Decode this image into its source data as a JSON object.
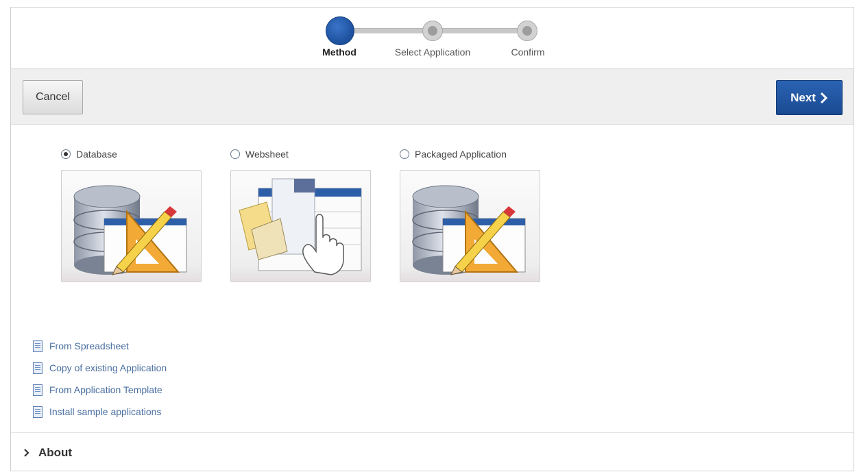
{
  "wizard": {
    "steps": [
      {
        "label": "Method",
        "state": "current"
      },
      {
        "label": "Select Application",
        "state": "future"
      },
      {
        "label": "Confirm",
        "state": "future"
      }
    ]
  },
  "buttons": {
    "cancel": "Cancel",
    "next": "Next",
    "next_icon": "chevron-right-icon"
  },
  "options": [
    {
      "label": "Database",
      "checked": true,
      "image": "database-icon"
    },
    {
      "label": "Websheet",
      "checked": false,
      "image": "websheet-icon"
    },
    {
      "label": "Packaged Application",
      "checked": false,
      "image": "database-icon"
    }
  ],
  "links": [
    "From Spreadsheet",
    "Copy of existing Application",
    "From Application Template",
    "Install sample applications"
  ],
  "about": {
    "label": "About",
    "icon": "chevron-right-icon"
  },
  "colors": {
    "primary": "#1f5199",
    "link": "#4a6fa0"
  }
}
